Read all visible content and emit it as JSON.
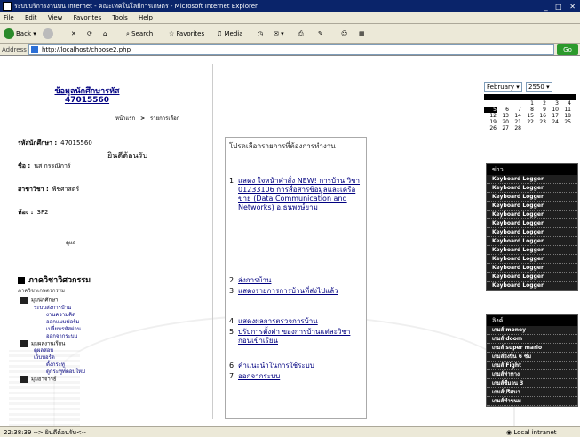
{
  "window": {
    "title": "ระบบบริการงานบน Internet - คณะเทคโนโลยีการเกษตร - Microsoft Internet Explorer"
  },
  "menubar": [
    "File",
    "Edit",
    "View",
    "Favorites",
    "Tools",
    "Help"
  ],
  "toolbar": {
    "back": "Back",
    "search": "Search",
    "favorites": "Favorites",
    "media": "Media"
  },
  "address": {
    "label": "Address",
    "url": "http://localhost/choose2.php",
    "go": "Go"
  },
  "student": {
    "title": "ข้อมูลนักศึกษารหัส 47015560",
    "id_label": "รหัสนักศึกษา :",
    "id_value": "47015560",
    "name_label": "ชื่อ :",
    "name_value": "นส กรรณิการ์",
    "major_label": "สาขาวิชา :",
    "major_value": "พืชศาสตร์",
    "room_label": "ห้อง :",
    "room_value": "3F2",
    "small": "ดูแล"
  },
  "breadcrumb": {
    "home": "หน้าแรก",
    "sep": ">",
    "current": "รายการเลือก"
  },
  "welcome": "ยินดีต้อนรับ",
  "section": {
    "heading": "ภาควิชาวิศวกรรม",
    "sub": "ภาควิชาเกษตรกรรม",
    "tree": [
      {
        "type": "folder",
        "label": "มุมนักศึกษา"
      },
      {
        "type": "node",
        "label": "ระบบส่งการบ้าน"
      },
      {
        "type": "node2",
        "label": "งานความคิด"
      },
      {
        "type": "node2",
        "label": "ออกแบบฟอร์ม"
      },
      {
        "type": "node2",
        "label": "เปลี่ยนรหัสผ่าน"
      },
      {
        "type": "node2",
        "label": "ออกจากระบบ"
      },
      {
        "type": "folder",
        "label": "มุมผลงานเรียน"
      },
      {
        "type": "node",
        "label": "ดูผลสอบ"
      },
      {
        "type": "node",
        "label": "เว็บบอร์ด"
      },
      {
        "type": "node2",
        "label": "ตั้งกระทู้"
      },
      {
        "type": "node2",
        "label": "ดูกระทู้ที่ตอบใหม่"
      },
      {
        "type": "folder",
        "label": "มุมอาจารย์"
      }
    ]
  },
  "menu": {
    "intro": "โปรดเลือกรายการที่ต้องการทำงาน",
    "items": [
      {
        "num": "1",
        "text": "แสดง ใจหน้าคำสั่ง NEW! การบ้าน วิชา 01233106 การสื่อสารข้อมูลและเครือข่าย (Data Communication and Networks) อ.ธนพงษ์ยาม"
      },
      {
        "num": "2",
        "text": "ส่งการบ้าน"
      },
      {
        "num": "3",
        "text": "แสดงรายการการบ้านที่ส่งไปแล้ว"
      },
      {
        "num": "4",
        "text": "แสดงผลการตรวจการบ้าน"
      },
      {
        "num": "5",
        "text": "ปรับการตั้งค่า ของการบ้านแต่ละวิชา ก่อนเข้าเรียน"
      },
      {
        "num": "6",
        "text": "คำแนะนำในการใช้ระบบ"
      },
      {
        "num": "7",
        "text": "ออกจากระบบ"
      }
    ]
  },
  "calendar": {
    "month": "February",
    "year": "2550",
    "rows": [
      [
        "",
        "",
        "",
        "1",
        "2",
        "3",
        "4"
      ],
      [
        "5",
        "6",
        "7",
        "8",
        "9",
        "10",
        "11"
      ],
      [
        "12",
        "13",
        "14",
        "15",
        "16",
        "17",
        "18"
      ],
      [
        "19",
        "20",
        "21",
        "22",
        "23",
        "24",
        "25"
      ],
      [
        "26",
        "27",
        "28",
        "",
        "",
        "",
        ""
      ]
    ],
    "today": "5"
  },
  "panel1": {
    "title": "ข่าว",
    "items": [
      "Keyboard Logger",
      "Keyboard Logger",
      "Keyboard Logger",
      "Keyboard Logger",
      "Keyboard Logger",
      "Keyboard Logger",
      "Keyboard Logger",
      "Keyboard Logger",
      "Keyboard Logger",
      "Keyboard Logger",
      "Keyboard Logger",
      "Keyboard Logger",
      "Keyboard Logger"
    ]
  },
  "panel2": {
    "title": "ลิงค์",
    "items": [
      "เกมส์ money",
      "เกมส์ doom",
      "เกมส์ super mario",
      "เกมส์ยิงปืน 6 ซีม",
      "เกมส์ Fight",
      "เกมส์ท่าทาง",
      "เกมส์ซีมอน 3",
      "เกมส์ปริศนา",
      "เกมส์ทำขนม"
    ]
  },
  "status": {
    "left": "22:38:39 --> ยินดีต้อนรับ<--",
    "right": "Local intranet"
  }
}
